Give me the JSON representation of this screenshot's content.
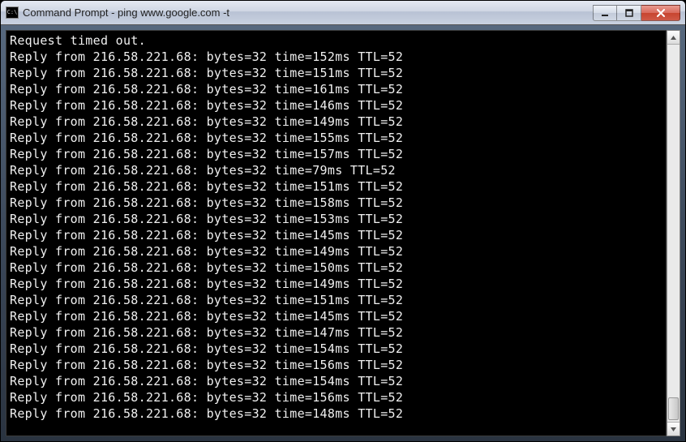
{
  "titlebar": {
    "icon_label": "C:\\",
    "title": "Command Prompt - ping  www.google.com -t"
  },
  "console": {
    "timeout_line": "Request timed out.",
    "reply_prefix": "Reply from ",
    "ip": "216.58.221.68",
    "bytes_label": "bytes=32",
    "time_prefix": "time=",
    "time_suffix": "ms",
    "ttl_label": "TTL=52",
    "times": [
      152,
      151,
      161,
      146,
      149,
      155,
      157,
      79,
      151,
      158,
      153,
      145,
      149,
      150,
      149,
      151,
      145,
      147,
      154,
      156,
      154,
      156,
      148
    ]
  }
}
